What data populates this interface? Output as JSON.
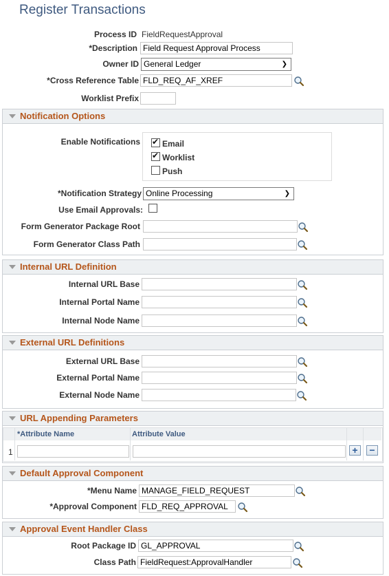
{
  "page": {
    "title": "Register Transactions"
  },
  "header_fields": {
    "process_id": {
      "label": "Process ID",
      "value": "FieldRequestApproval"
    },
    "description": {
      "label": "*Description",
      "value": "Field Request Approval Process"
    },
    "owner_id": {
      "label": "Owner ID",
      "value": "General Ledger"
    },
    "cross_reference_table": {
      "label": "*Cross Reference Table",
      "value": "FLD_REQ_AF_XREF"
    },
    "worklist_prefix": {
      "label": "Worklist Prefix",
      "value": ""
    }
  },
  "notification_options": {
    "title": "Notification Options",
    "enable_notifications_label": "Enable Notifications",
    "checkboxes": [
      {
        "label": "Email",
        "checked": true
      },
      {
        "label": "Worklist",
        "checked": true
      },
      {
        "label": "Push",
        "checked": false
      }
    ],
    "notification_strategy": {
      "label": "*Notification Strategy",
      "value": "Online Processing"
    },
    "use_email_approvals": {
      "label": "Use Email Approvals:",
      "checked": false
    },
    "form_generator_package_root": {
      "label": "Form Generator Package Root",
      "value": ""
    },
    "form_generator_class_path": {
      "label": "Form Generator Class Path",
      "value": ""
    }
  },
  "internal_url": {
    "title": "Internal URL Definition",
    "fields": [
      {
        "label": "Internal URL Base",
        "value": ""
      },
      {
        "label": "Internal Portal Name",
        "value": ""
      },
      {
        "label": "Internal Node Name",
        "value": ""
      }
    ]
  },
  "external_url": {
    "title": "External URL Definitions",
    "fields": [
      {
        "label": "External URL Base",
        "value": ""
      },
      {
        "label": "External Portal Name",
        "value": ""
      },
      {
        "label": "External Node Name",
        "value": ""
      }
    ]
  },
  "url_params": {
    "title": "URL Appending Parameters",
    "columns": [
      "*Attribute Name",
      "Attribute Value"
    ],
    "rows": [
      {
        "num": "1",
        "name": "",
        "value": ""
      }
    ],
    "add_symbol": "+",
    "delete_symbol": "−"
  },
  "default_approval": {
    "title": "Default Approval Component",
    "menu_name": {
      "label": "*Menu Name",
      "value": "MANAGE_FIELD_REQUEST"
    },
    "approval_component": {
      "label": "*Approval Component",
      "value": "FLD_REQ_APPROVAL"
    }
  },
  "event_handler": {
    "title": "Approval Event Handler Class",
    "root_package_id": {
      "label": "Root Package ID",
      "value": "GL_APPROVAL"
    },
    "class_path": {
      "label": "Class Path",
      "value": "FieldRequest:ApprovalHandler"
    }
  },
  "colors": {
    "title": "#3f5a80",
    "section_title": "#b5561b",
    "section_header_bg": "#edf0f2"
  }
}
